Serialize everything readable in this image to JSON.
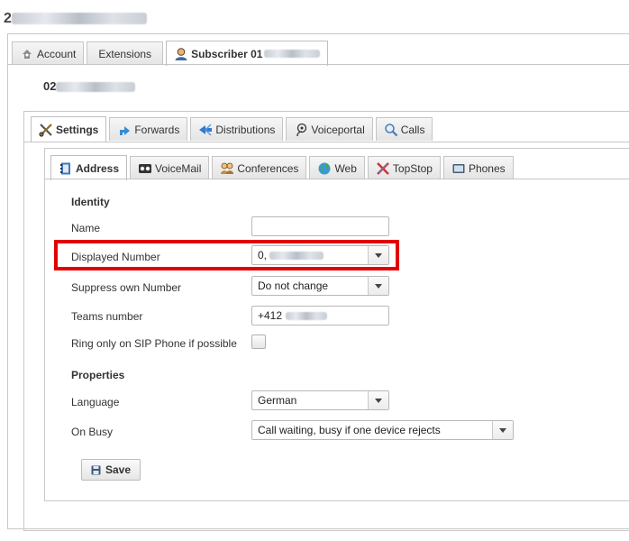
{
  "page": {
    "title": "2"
  },
  "tabs_level1": [
    {
      "label": "Account",
      "icon": "account-icon"
    },
    {
      "label": "Extensions",
      "icon": ""
    },
    {
      "label": "Subscriber 01",
      "icon": "subscriber-icon"
    }
  ],
  "subscriber": {
    "number_prefix": "02"
  },
  "tabs_level2": [
    {
      "label": "Settings",
      "icon": "wrench-scissors-icon"
    },
    {
      "label": "Forwards",
      "icon": "forward-arrow-icon"
    },
    {
      "label": "Distributions",
      "icon": "distribution-icon"
    },
    {
      "label": "Voiceportal",
      "icon": "voiceportal-icon"
    },
    {
      "label": "Calls",
      "icon": "calls-icon"
    }
  ],
  "tabs_level3": [
    {
      "label": "Address",
      "icon": "address-book-icon"
    },
    {
      "label": "VoiceMail",
      "icon": "voicemail-icon"
    },
    {
      "label": "Conferences",
      "icon": "conference-icon"
    },
    {
      "label": "Web",
      "icon": "globe-icon"
    },
    {
      "label": "TopStop",
      "icon": "topstop-icon"
    },
    {
      "label": "Phones",
      "icon": "phone-icon"
    }
  ],
  "form": {
    "identity_heading": "Identity",
    "name_label": "Name",
    "name_value": "",
    "displayed_number_label": "Displayed Number",
    "displayed_number_value": "0,",
    "suppress_label": "Suppress own Number",
    "suppress_value": "Do not change",
    "teams_label": "Teams number",
    "teams_value": "+412",
    "ring_label": "Ring only on SIP Phone if possible",
    "properties_heading": "Properties",
    "language_label": "Language",
    "language_value": "German",
    "onbusy_label": "On Busy",
    "onbusy_value": "Call waiting, busy if one device rejects",
    "save_label": "Save"
  },
  "colors": {
    "highlight": "#e30000"
  }
}
